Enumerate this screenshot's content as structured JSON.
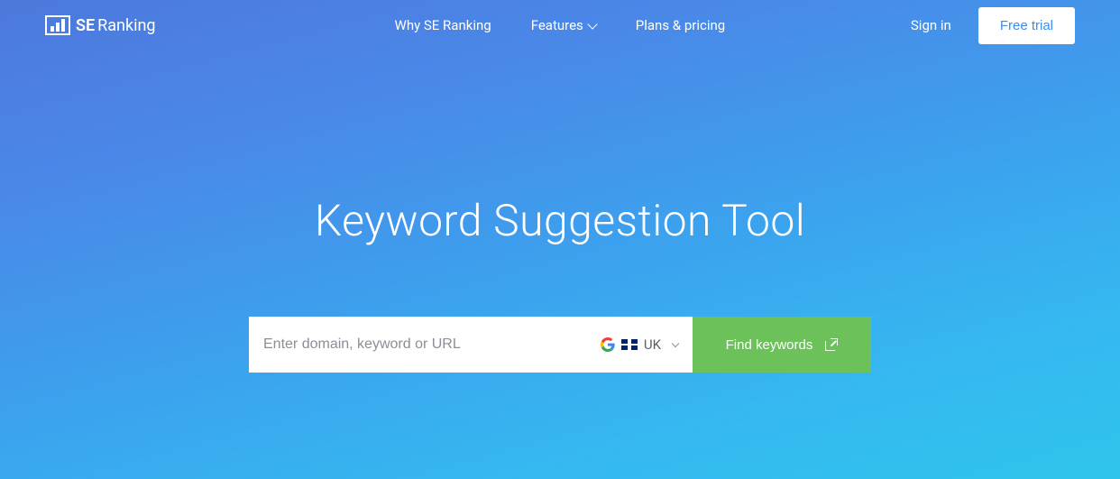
{
  "brand": {
    "name": "SE Ranking",
    "prefix": "SE",
    "suffix": "Ranking"
  },
  "nav": {
    "why": "Why SE Ranking",
    "features": "Features",
    "plans": "Plans & pricing"
  },
  "header": {
    "signin": "Sign in",
    "trial": "Free trial"
  },
  "hero": {
    "title": "Keyword Suggestion Tool"
  },
  "search": {
    "placeholder": "Enter domain, keyword or URL",
    "region": "UK",
    "button": "Find keywords"
  }
}
